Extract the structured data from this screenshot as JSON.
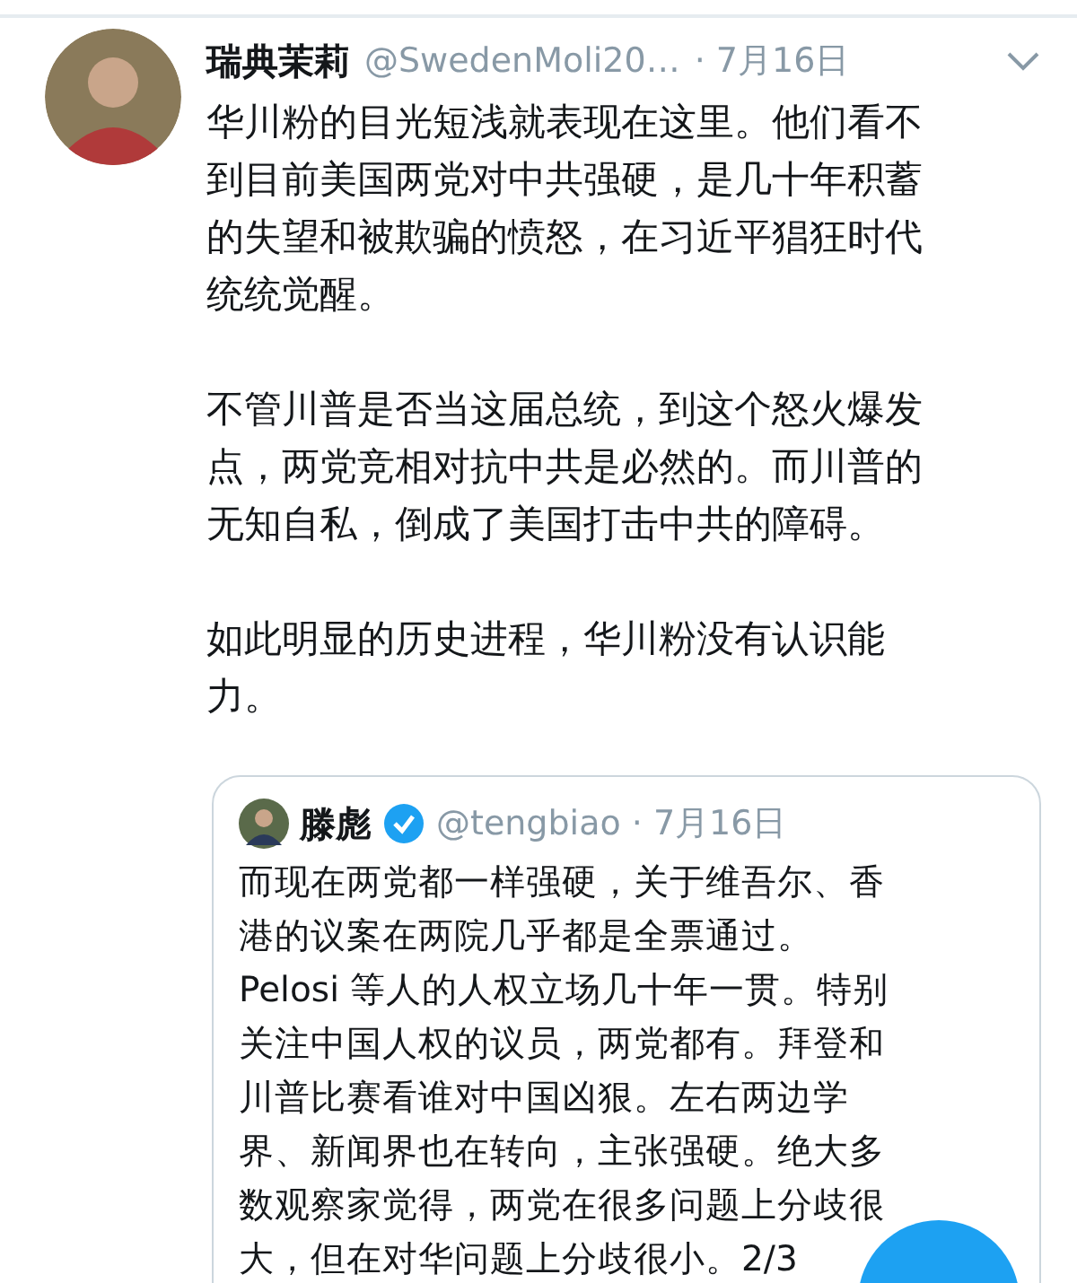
{
  "tweet": {
    "name": "瑞典茉莉",
    "handle": "@SwedenMoli20…",
    "date": "· 7月16日",
    "paragraphs": [
      [
        "华川粉的目光短浅就表现在这里。他们看不",
        "到目前美国两党对中共强硬，是几十年积蓄",
        "的失望和被欺骗的愤怒，在习近平猖狂时代",
        "统统觉醒。"
      ],
      [
        "不管川普是否当这届总统，到这个怒火爆发",
        "点，两党竞相对抗中共是必然的。而川普的",
        "无知自私，倒成了美国打击中共的障碍。"
      ],
      [
        "如此明显的历史进程，华川粉没有认识能",
        "力。"
      ]
    ],
    "quote": {
      "name": "滕彪",
      "verified": true,
      "handle": "@tengbiao",
      "date": "· 7月16日",
      "lines": [
        "而现在两党都一样强硬，关于维吾尔、香",
        "港的议案在两院几乎都是全票通过。",
        "Pelosi 等人的人权立场几十年一贯。特别",
        "关注中国人权的议员，两党都有。拜登和",
        "川普比赛看谁对中国凶狠。左右两边学",
        "界、新闻界也在转向，主张强硬。绝大多",
        "数观察家觉得，两党在很多问题上分歧很",
        "大，但在对华问题上分歧很小。2/3"
      ]
    }
  }
}
